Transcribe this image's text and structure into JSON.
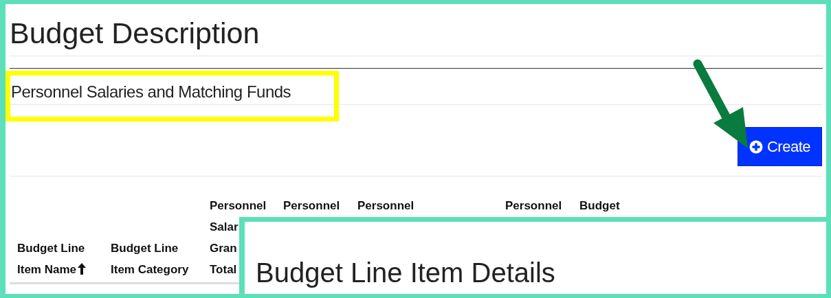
{
  "title": "Budget Description",
  "section_title": "Personnel Salaries and Matching Funds",
  "create_button": {
    "label": "Create"
  },
  "table": {
    "columns": [
      {
        "kind": "short",
        "lines": [
          "Budget Line",
          "Item Name"
        ],
        "sorted": true
      },
      {
        "kind": "short",
        "lines": [
          "Budget Line",
          "Item Category"
        ],
        "sorted": false
      },
      {
        "kind": "tall",
        "lines": [
          "Personnel",
          "Salar",
          "Gran",
          "Total"
        ],
        "sorted": false
      },
      {
        "kind": "tall",
        "lines": [
          "Personnel"
        ],
        "sorted": false
      },
      {
        "kind": "tall",
        "lines": [
          "Personnel"
        ],
        "sorted": false
      },
      {
        "kind": "tall",
        "lines": [
          "Personnel"
        ],
        "sorted": false
      },
      {
        "kind": "tall",
        "lines": [
          "Budget"
        ],
        "sorted": false
      }
    ]
  },
  "overlay": {
    "title": "Budget Line Item Details"
  }
}
